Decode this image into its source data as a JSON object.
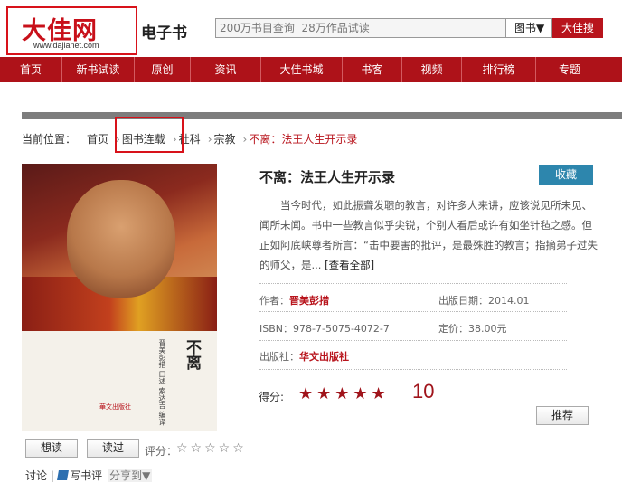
{
  "header": {
    "logo_text": "大佳网",
    "logo_url": "www.dajianet.com",
    "site_title": "电子书",
    "search_placeholder": "200万书目查询  28万作品试读",
    "search_category": "图书▼",
    "search_button": "大佳搜"
  },
  "nav": [
    "首页",
    "新书试读",
    "原创",
    "资讯",
    "大佳书城",
    "书客",
    "视频",
    "排行榜",
    "专题"
  ],
  "breadcrumb": {
    "label": "当前位置：",
    "items": [
      "首页",
      "图书连载",
      "社科",
      "宗教"
    ],
    "current": "不离：法王人生开示录"
  },
  "cover": {
    "title": "不离",
    "author": "晋美彭措 口述 索达吉 编译",
    "publisher": "華文出版社"
  },
  "book": {
    "title": "不离：法王人生开示录",
    "collect": "收藏",
    "description": "当今时代，如此振聋发聩的教言，对许多人来讲，应该说见所未见、闻所未闻。书中一些教言似乎尖锐，个别人看后或许有如坐针毡之感。但正如阿底峡尊者所言：“击中要害的批评，是最殊胜的教言；指摘弟子过失的师父，是...",
    "more": "[查看全部]",
    "author_label": "作者：",
    "author": "晋美彭措",
    "date_label": "出版日期：",
    "date": "2014.01",
    "isbn_label": "ISBN：",
    "isbn": "978-7-5075-4072-7",
    "price_label": "定价：",
    "price": "38.00元",
    "publisher_label": "出版社：",
    "publisher": "华文出版社",
    "score_label": "得分:",
    "score": "10",
    "recommend": "推荐"
  },
  "actions": {
    "want": "想读",
    "read": "读过",
    "rate_label": "评分：",
    "discuss": "讨论",
    "write_review": "写书评",
    "share": "分享到▼"
  }
}
